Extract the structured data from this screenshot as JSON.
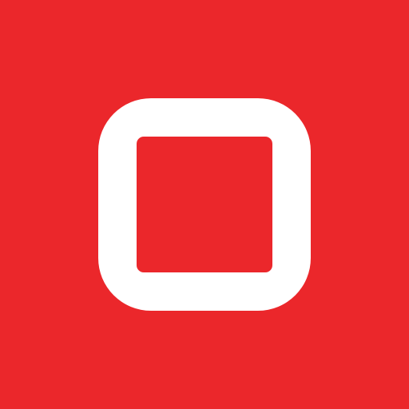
{
  "app_icon": {
    "icon_name": "rounded-square-outline-icon",
    "colors": {
      "background": "#EB272B",
      "foreground": "#FFFFFF"
    }
  }
}
